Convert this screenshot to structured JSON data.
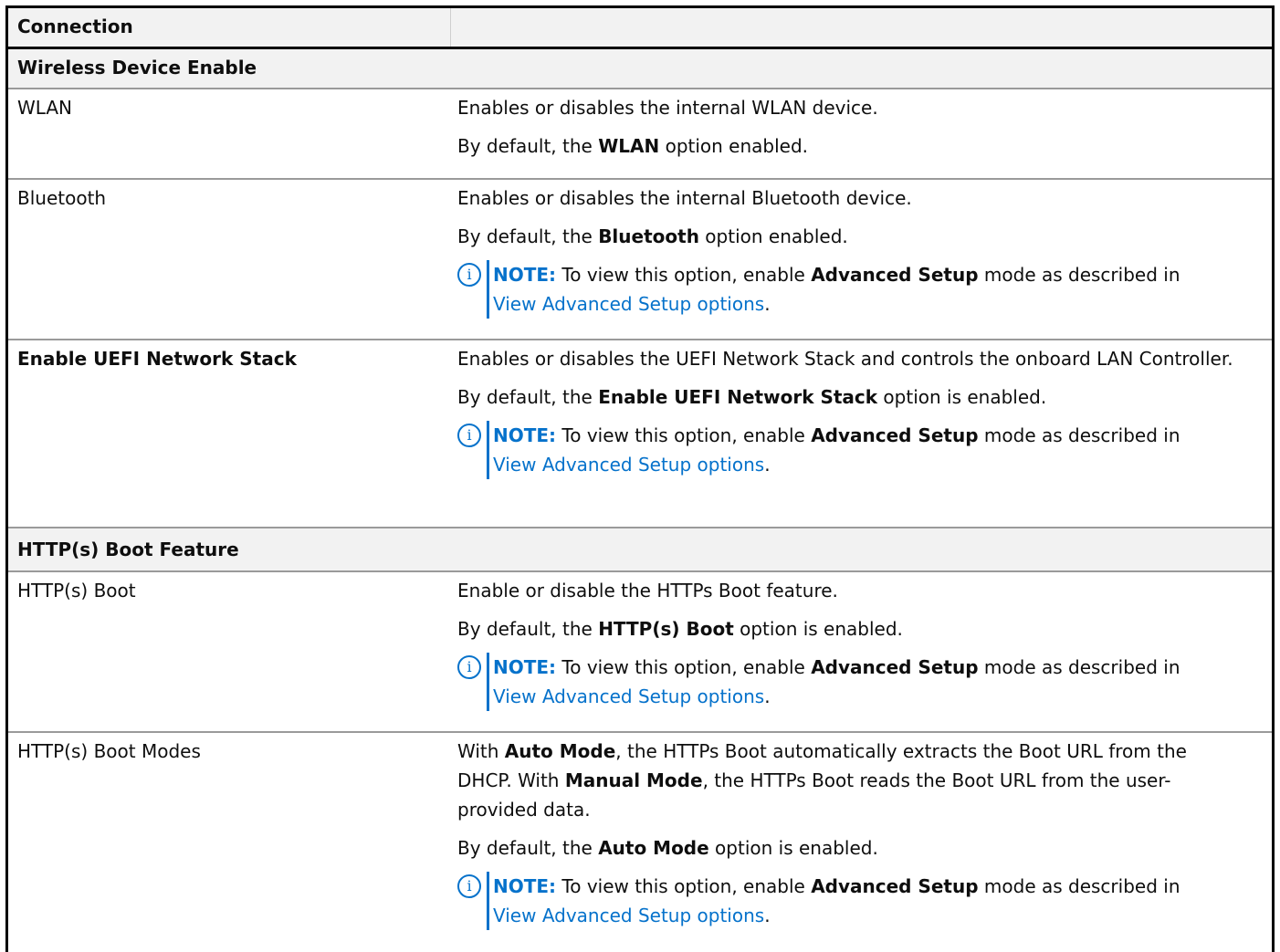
{
  "table": {
    "header": "Connection",
    "sections": [
      {
        "title": "Wireless Device Enable",
        "rows": [
          {
            "name": "WLAN",
            "desc": "Enables or disables the internal WLAN device.",
            "default_pre": "By default, the ",
            "default_bold": "WLAN",
            "default_post": " option enabled."
          },
          {
            "name": "Bluetooth",
            "desc": "Enables or disables the internal Bluetooth device.",
            "default_pre": "By default, the ",
            "default_bold": "Bluetooth",
            "default_post": " option enabled.",
            "note": true
          }
        ]
      },
      {
        "rows": [
          {
            "name": "Enable UEFI Network Stack",
            "bold_name": true,
            "desc": "Enables or disables the UEFI Network Stack and controls the onboard LAN Controller.",
            "default_pre": "By default, the ",
            "default_bold": "Enable UEFI Network Stack",
            "default_post": " option is enabled.",
            "note": true
          }
        ]
      },
      {
        "title": "HTTP(s) Boot Feature",
        "rows": [
          {
            "name": "HTTP(s) Boot",
            "desc": "Enable or disable the HTTPs Boot feature.",
            "default_pre": "By default, the ",
            "default_bold": "HTTP(s) Boot",
            "default_post": " option is enabled.",
            "note": true
          },
          {
            "name": "HTTP(s) Boot Modes",
            "desc_parts": [
              "With ",
              "Auto Mode",
              ", the HTTPs Boot automatically extracts the Boot URL from the DHCP. With ",
              "Manual Mode",
              ", the HTTPs Boot reads the Boot URL from the user-provided data."
            ],
            "default_pre": "By default, the ",
            "default_bold": "Auto Mode",
            "default_post": " option is enabled.",
            "note": true
          }
        ]
      }
    ]
  },
  "note": {
    "icon": "info-icon",
    "label": "NOTE:",
    "text_pre": " To view this option, enable ",
    "text_bold": "Advanced Setup",
    "text_post": " mode as described in ",
    "link": "View Advanced Setup options",
    "end": "."
  },
  "colors": {
    "accent": "#0672cb",
    "header_bg": "#f2f2f2"
  }
}
